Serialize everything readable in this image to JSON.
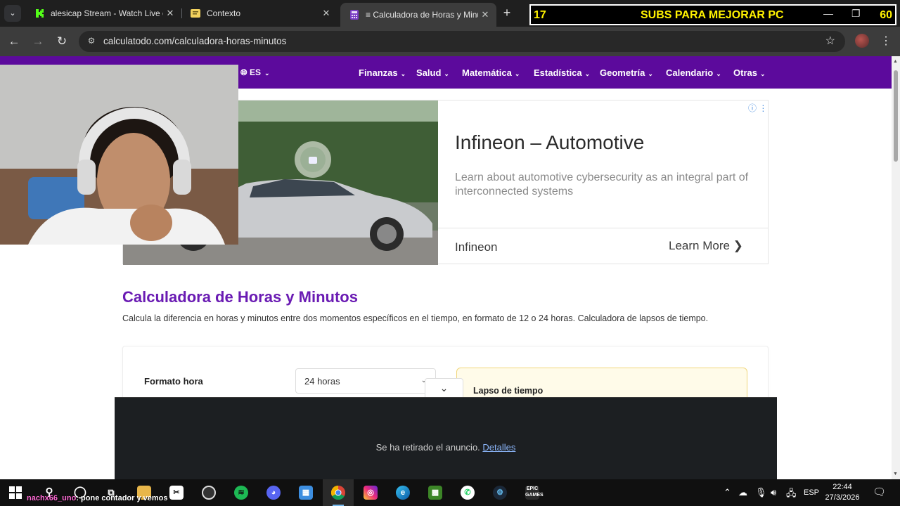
{
  "tabs": [
    {
      "title": "alesicap Stream - Watch Live on",
      "favicon": "kick-icon",
      "active": false
    },
    {
      "title": "Contexto",
      "favicon": "contexto-icon",
      "active": false
    },
    {
      "title": "≡ Calculadora de Horas y Minu",
      "favicon": "calculatodo-icon",
      "active": true
    }
  ],
  "overlay": {
    "left": "17",
    "middle": "SUBS PARA MEJORAR PC",
    "right": "60"
  },
  "address": {
    "url": "calculatodo.com/calculadora-horas-minutos"
  },
  "site_nav": {
    "language": "ES",
    "items": [
      "Finanzas",
      "Salud",
      "Matemática",
      "Estadística",
      "Geometría",
      "Calendario",
      "Otras"
    ]
  },
  "ad": {
    "headline": "Infineon – Automotive",
    "description": "Learn about automotive cybersecurity as an integral part of interconnected systems",
    "brand": "Infineon",
    "cta": "Learn More"
  },
  "content": {
    "title": "Calculadora de Horas y Minutos",
    "intro": "Calcula la diferencia en horas y minutos entre dos momentos específicos en el tiempo, en formato de 12 o 24 horas. Calculadora de lapsos de tiempo.",
    "format_label": "Formato hora",
    "format_value": "24 horas",
    "result_title": "Lapso de tiempo"
  },
  "ad_removed": {
    "message": "Se ha retirado el anuncio.",
    "link": "Detalles"
  },
  "chat": {
    "user": "nachx66_uno",
    "message": ": pone contador y vemos"
  },
  "taskbar": {
    "language": "ESP",
    "time": "22:44",
    "date": "27/3/2026"
  },
  "colors": {
    "brand_purple": "#5c0a9c",
    "title_purple": "#6a1bb3",
    "overlay_text": "#fff200"
  }
}
